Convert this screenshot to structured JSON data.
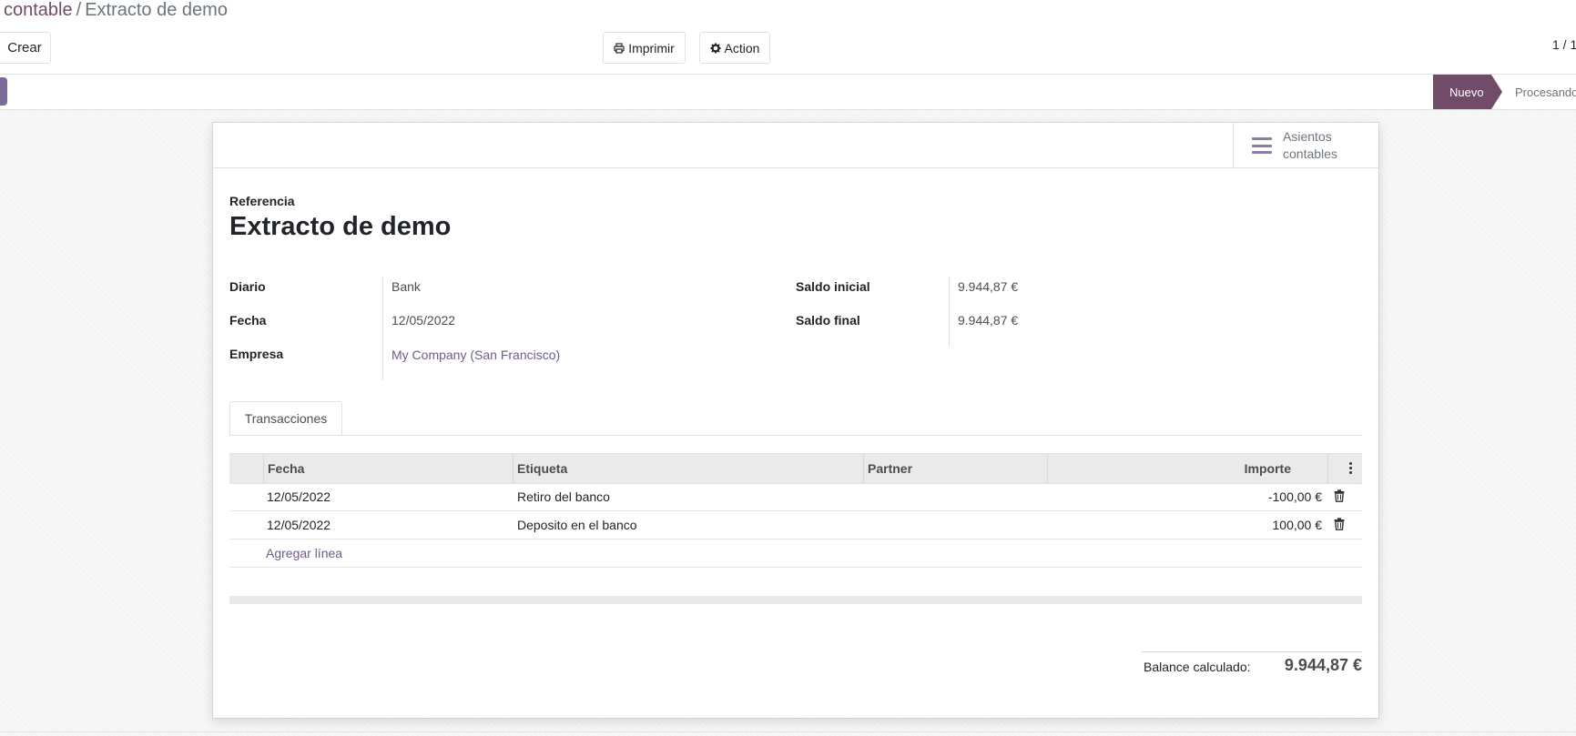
{
  "breadcrumb": {
    "parent": "contable",
    "separator": "/",
    "current": "Extracto de demo"
  },
  "toolbar": {
    "create_label": "Crear",
    "print_label": "Imprimir",
    "action_label": "Action"
  },
  "pager": {
    "value": "1 / 1"
  },
  "statusbar": {
    "stages": [
      "Nuevo",
      "Procesando"
    ],
    "active_stage": "Nuevo"
  },
  "smart_button": {
    "line1": "Asientos",
    "line2": "contables"
  },
  "form": {
    "reference_label": "Referencia",
    "title": "Extracto de demo",
    "left_fields": [
      {
        "label": "Diario",
        "value": "Bank"
      },
      {
        "label": "Fecha",
        "value": "12/05/2022"
      },
      {
        "label": "Empresa",
        "value": "My Company (San Francisco)"
      }
    ],
    "right_fields": [
      {
        "label": "Saldo inicial",
        "value": "9.944,87 €"
      },
      {
        "label": "Saldo final",
        "value": "9.944,87 €"
      }
    ]
  },
  "tabs": [
    {
      "label": "Transacciones"
    }
  ],
  "table": {
    "columns": [
      "Fecha",
      "Etiqueta",
      "Partner",
      "Importe"
    ],
    "rows": [
      {
        "fecha": "12/05/2022",
        "etiqueta": "Retiro del banco",
        "partner": "",
        "importe": "-100,00 €"
      },
      {
        "fecha": "12/05/2022",
        "etiqueta": "Deposito en el banco",
        "partner": "",
        "importe": "100,00 €"
      }
    ],
    "add_line_label": "Agregar línea"
  },
  "footer": {
    "balance_label": "Balance calculado:",
    "balance_value": "9.944,87 €"
  },
  "colors": {
    "brand": "#714b67",
    "link": "#6f5b8c",
    "header_bg": "#eaeaea"
  }
}
